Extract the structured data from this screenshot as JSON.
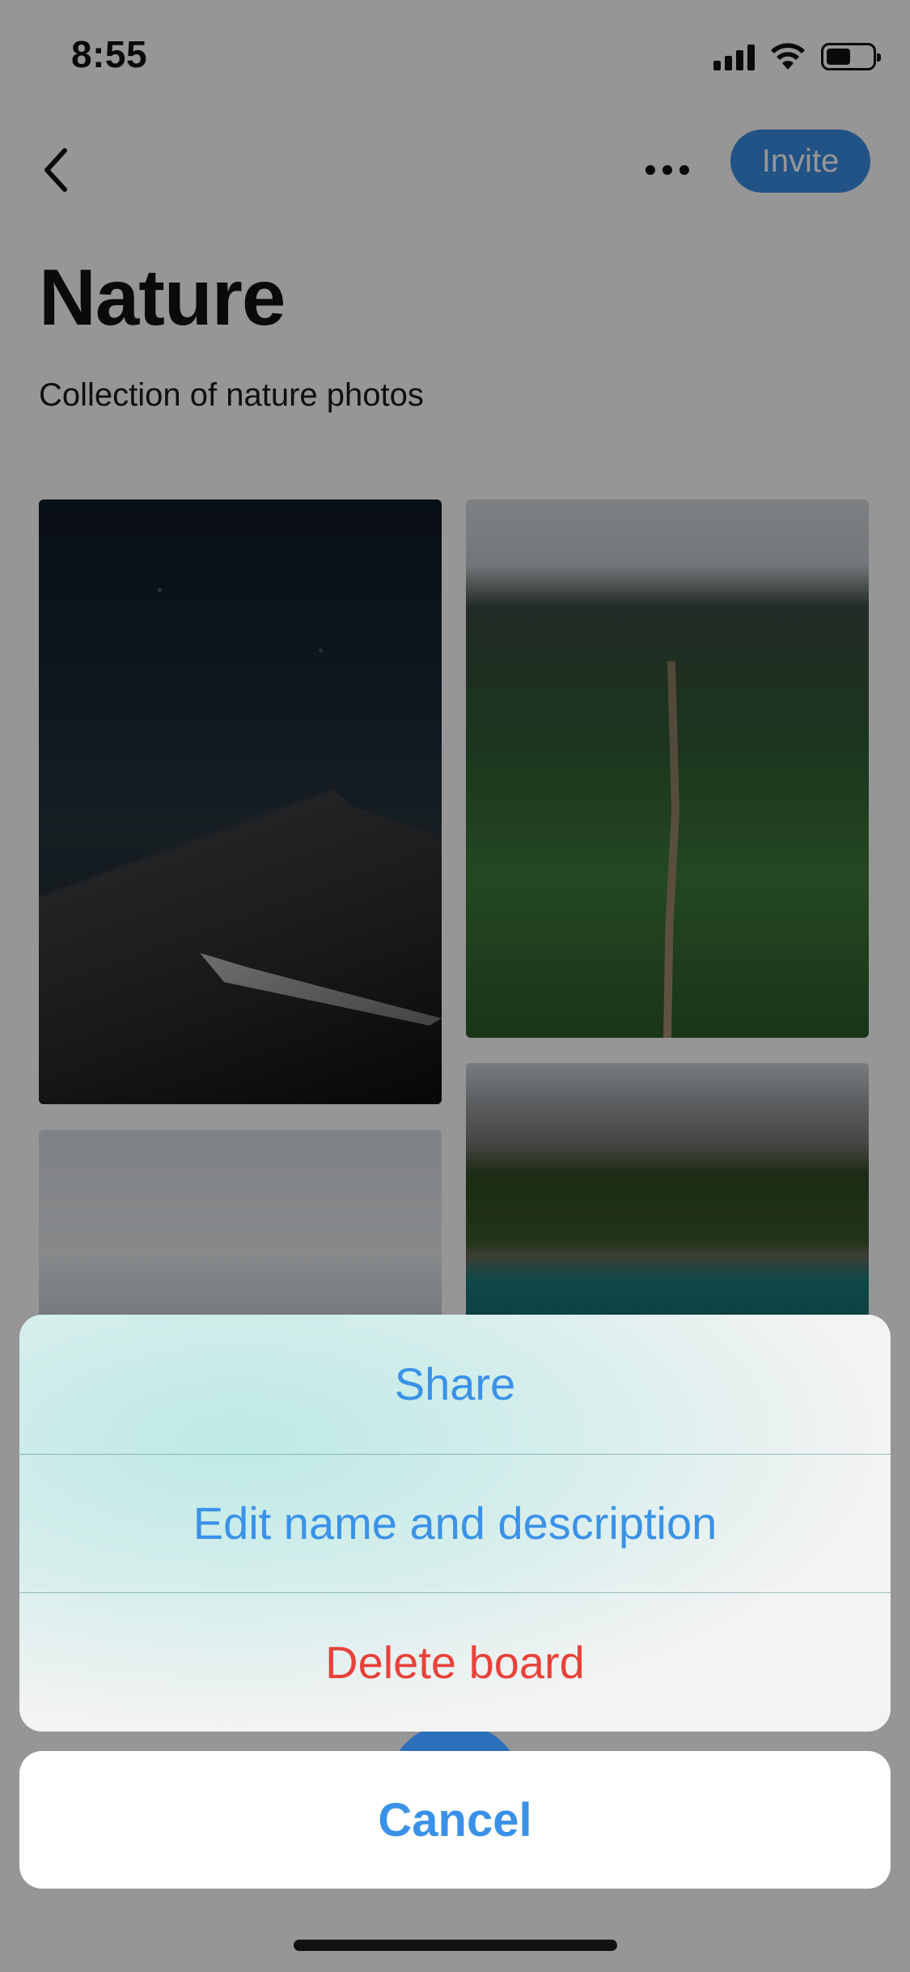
{
  "status_bar": {
    "time": "8:55",
    "icons": [
      "cellular-signal-icon",
      "wifi-icon",
      "battery-icon"
    ]
  },
  "nav": {
    "back_icon": "chevron-left-icon",
    "more_icon": "ellipsis-icon",
    "invite_label": "Invite"
  },
  "board": {
    "title": "Nature",
    "description": "Collection of nature photos",
    "photos": [
      {
        "subject": "starry-night-mountains"
      },
      {
        "subject": "green-ridge-trail"
      },
      {
        "subject": "cloudy-sky-island"
      },
      {
        "subject": "alpine-lake-forest"
      }
    ]
  },
  "action_sheet": {
    "items": [
      {
        "label": "Share",
        "style": "default"
      },
      {
        "label": "Edit name and description",
        "style": "default"
      },
      {
        "label": "Delete board",
        "style": "destructive"
      }
    ],
    "cancel_label": "Cancel"
  },
  "colors": {
    "accent": "#3a92e8",
    "invite_background": "#3b8de6",
    "destructive": "#e8413a",
    "dim_overlay": "rgba(0,0,0,0.41)"
  }
}
